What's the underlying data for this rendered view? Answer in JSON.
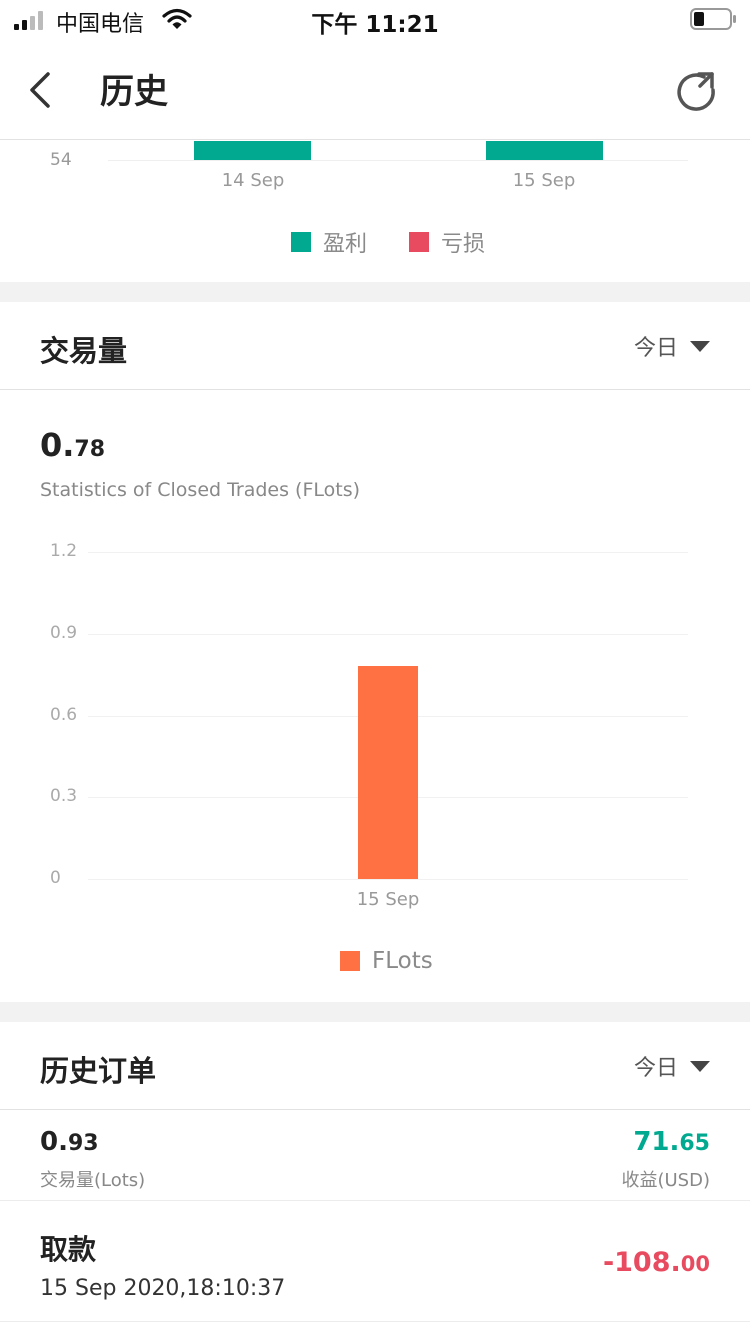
{
  "status_bar": {
    "carrier": "中国电信",
    "time": "下午 11:21"
  },
  "nav": {
    "title": "历史"
  },
  "profit_chart": {
    "y_label": "54",
    "categories": [
      "14 Sep",
      "15 Sep"
    ],
    "legend": [
      {
        "label": "盈利",
        "color": "#00a98f"
      },
      {
        "label": "亏损",
        "color": "#e84a5f"
      }
    ]
  },
  "volume_section": {
    "title": "交易量",
    "filter": "今日",
    "total_int": "0.",
    "total_dec": "78",
    "subtitle": "Statistics of Closed Trades (FLots)"
  },
  "chart_data": {
    "type": "bar",
    "categories": [
      "15 Sep"
    ],
    "series": [
      {
        "name": "FLots",
        "values": [
          0.78
        ],
        "color": "#ff7043"
      }
    ],
    "yticks": [
      "1.2",
      "0.9",
      "0.6",
      "0.3",
      "0"
    ],
    "ylim": [
      0,
      1.2
    ],
    "legend_position": "bottom-center",
    "grid": true
  },
  "orders_section": {
    "title": "历史订单",
    "filter": "今日",
    "lots_int": "0.",
    "lots_dec": "93",
    "lots_label": "交易量(Lots)",
    "profit_int": "71.",
    "profit_dec": "65",
    "profit_label": "收益(USD)",
    "orders": [
      {
        "type": "取款",
        "time": "15 Sep 2020,18:10:37",
        "amount_int": "-108.",
        "amount_dec": "00"
      }
    ]
  },
  "colors": {
    "profit": "#00a98f",
    "loss": "#e84a5f",
    "volume": "#ff7043"
  }
}
